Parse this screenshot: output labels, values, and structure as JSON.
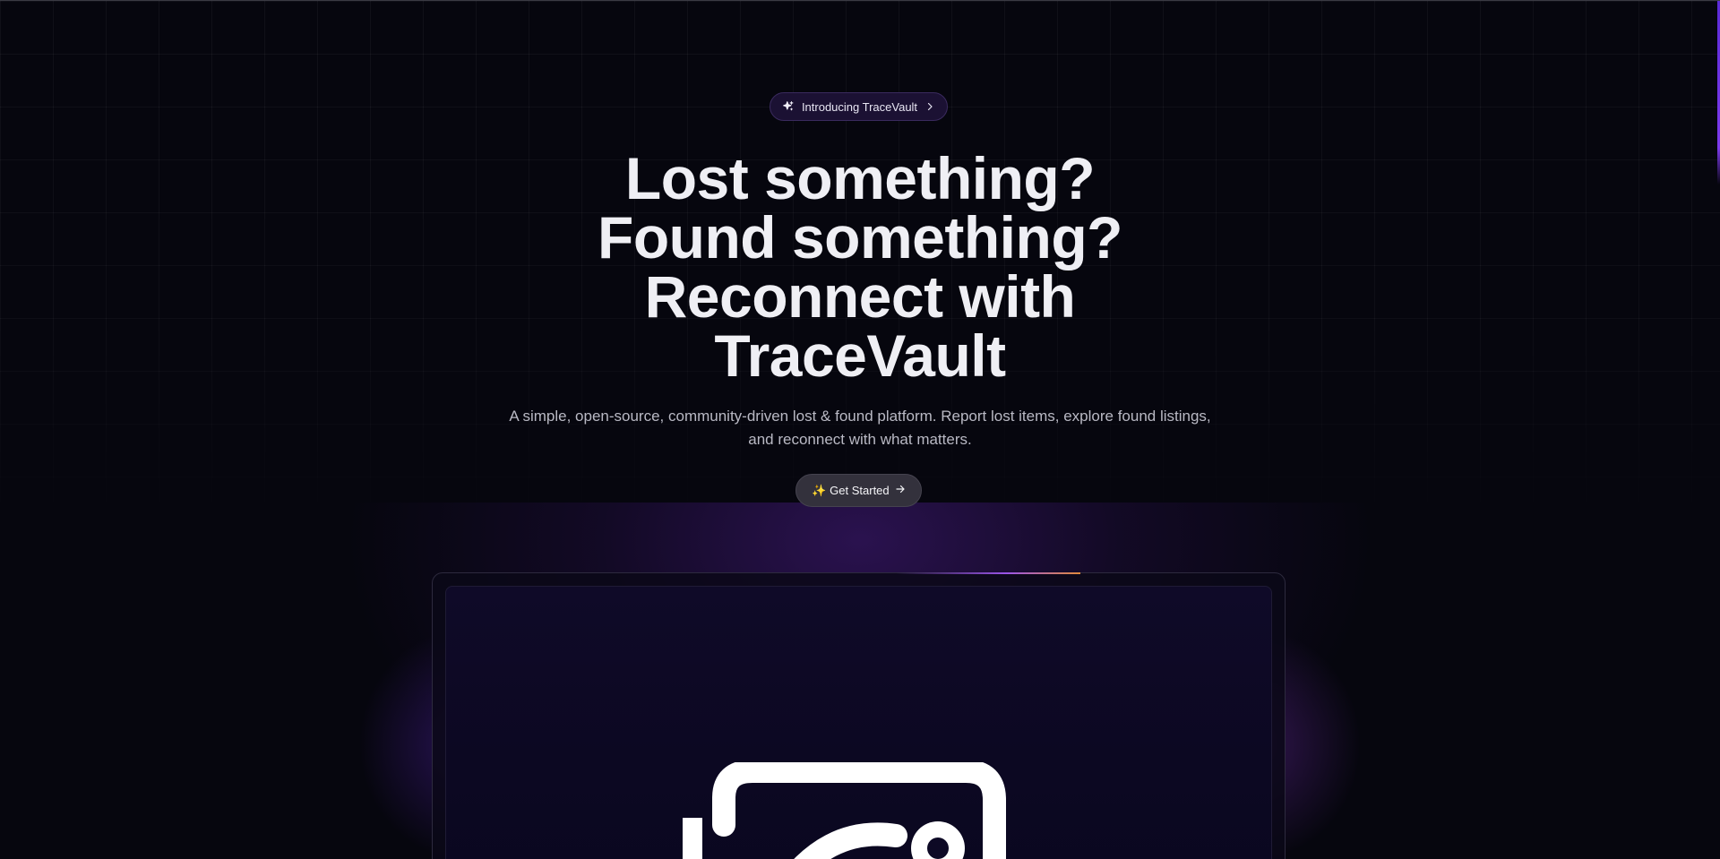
{
  "colors": {
    "background": "#06060e",
    "accent": "#7c3aed",
    "badge_bg": "#1b1133",
    "cta_bg": "#33313c"
  },
  "badge": {
    "icon": "sparkles-icon",
    "label": "Introducing TraceVault",
    "chevron_icon": "chevron-right-icon"
  },
  "hero": {
    "title_lines": [
      "Lost something?",
      "Found something?",
      "Reconnect with",
      "TraceVault"
    ],
    "subtitle": "A simple, open-source, community-driven lost & found platform. Report lost items, explore found listings, and reconnect with what matters."
  },
  "cta": {
    "label": "✨ Get Started",
    "arrow_icon": "arrow-right-icon"
  },
  "preview": {
    "logo_icon": "tracevault-logo-icon"
  }
}
